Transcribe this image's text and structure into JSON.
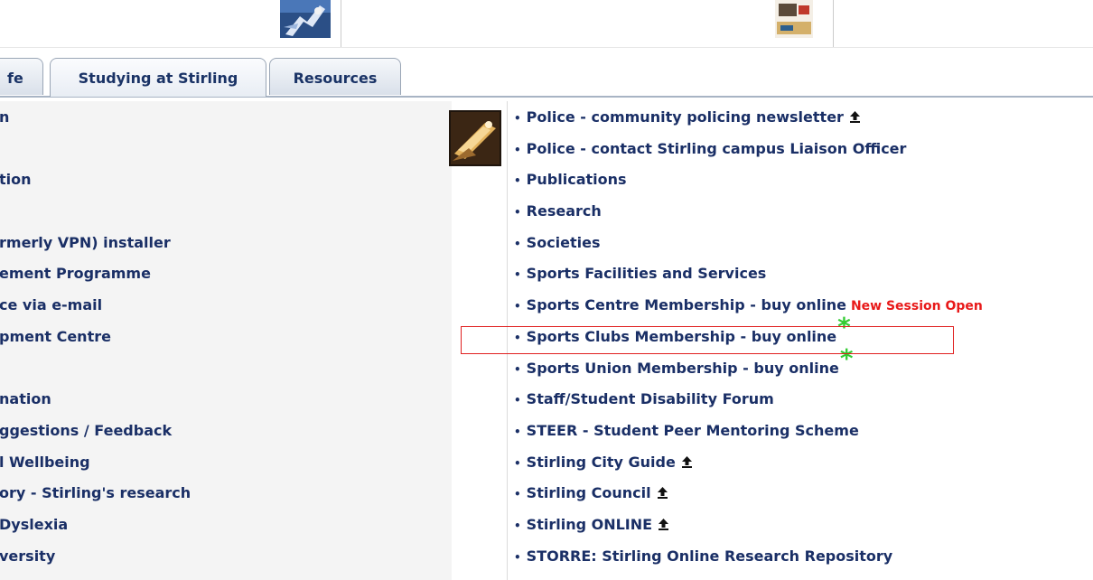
{
  "tabs": [
    {
      "label": "fe",
      "active": false
    },
    {
      "label": "Studying at Stirling",
      "active": true
    },
    {
      "label": "Resources",
      "active": false
    }
  ],
  "left_items": [
    "n",
    "",
    "tion",
    "",
    "rmerly VPN) installer",
    "ement Programme",
    "ce via e-mail",
    "pment Centre",
    "",
    "nation",
    "ggestions / Feedback",
    "l Wellbeing",
    "ory - Stirling's research",
    "Dyslexia",
    "versity"
  ],
  "right_items": [
    {
      "label": "Police - community policing newsletter",
      "external": true
    },
    {
      "label": "Police - contact Stirling campus Liaison Officer"
    },
    {
      "label": "Publications"
    },
    {
      "label": "Research"
    },
    {
      "label": "Societies"
    },
    {
      "label": "Sports Facilities and Services"
    },
    {
      "label": "Sports Centre Membership - buy online",
      "badge": "New Session Open"
    },
    {
      "label": "Sports Clubs Membership - buy online",
      "star": "*"
    },
    {
      "label": "Sports Union Membership - buy online",
      "star": "*"
    },
    {
      "label": "Staff/Student Disability Forum"
    },
    {
      "label": "STEER - Student Peer Mentoring Scheme"
    },
    {
      "label": "Stirling City Guide",
      "external": true
    },
    {
      "label": "Stirling Council",
      "external": true
    },
    {
      "label": "Stirling ONLINE",
      "external": true
    },
    {
      "label": "STORRE: Stirling Online Research Repository"
    }
  ],
  "icons": {
    "bullet": "bullet-icon",
    "external": "up-arrow-icon",
    "star": "green-star-icon"
  },
  "colors": {
    "link": "#1a2f66",
    "badge": "#e81919",
    "star": "#33cc33",
    "highlight": "#e02020"
  }
}
